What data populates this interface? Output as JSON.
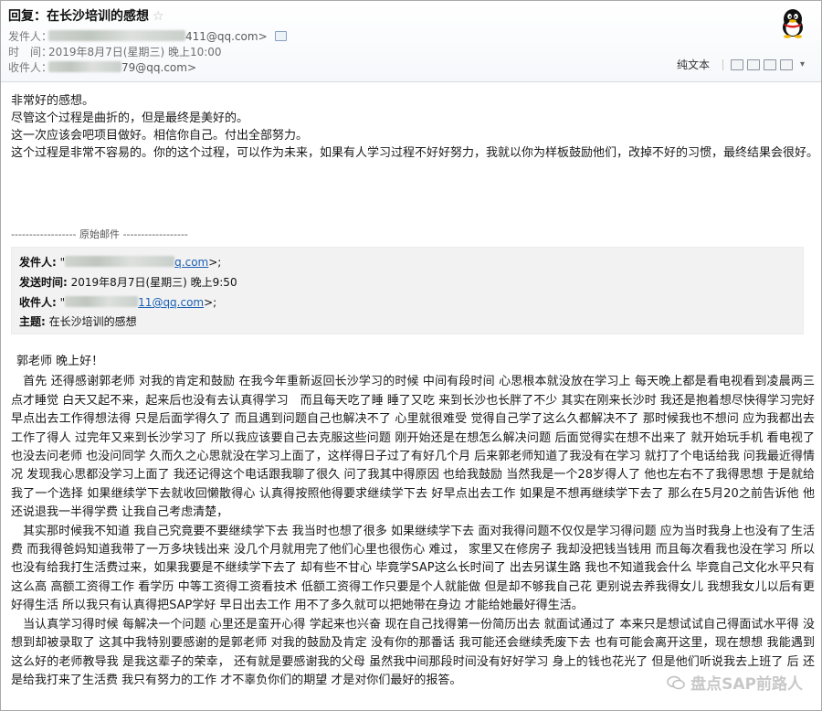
{
  "header": {
    "subject": "回复：在长沙培训的感想",
    "from_label": "发件人：",
    "from_addr": "411@qq.com>",
    "time_label": "时　间：",
    "time_value": "2019年8月7日(星期三) 晚上10:00",
    "to_label": "收件人：",
    "to_addr": "79@qq.com>",
    "plain_text": "纯文本"
  },
  "reply_lines": [
    "非常好的感想。",
    "尽管这个过程是曲折的，但是最终是美好的。",
    "这一次应该会吧项目做好。相信你自己。付出全部努力。",
    "这个过程是非常不容易的。你的这个过程，可以作为未来，如果有人学习过程不好好努力，我就以你为样板鼓励他们，改掉不好的习惯，最终结果会很好。"
  ],
  "original": {
    "title": "------------------ 原始邮件 ------------------",
    "from_label": "发件人:",
    "from_value": "\"",
    "from_addr": "q.com",
    "from_tail": ">;",
    "sent_label": "发送时间:",
    "sent_value": "2019年8月7日(星期三) 晚上9:50",
    "to_label": "收件人:",
    "to_value": "\"",
    "to_addr": "11@qq.com",
    "to_tail": ">;",
    "subject_label": "主题:",
    "subject_value": "在长沙培训的感想"
  },
  "letter": {
    "greeting": "郭老师 晚上好！",
    "paragraphs": [
      "　首先 还得感谢郭老师 对我的肯定和鼓励 在我今年重新返回长沙学习的时候 中间有段时间 心思根本就没放在学习上 每天晚上都是看电视看到凌晨两三点才睡觉 白天又起不来，起来后也没有去认真得学习　而且每天吃了睡 睡了又吃 来到长沙也长胖了不少 其实在刚来长沙时 我还是抱着想尽快得学习完好早点出去工作得想法得 只是后面学得久了 而且遇到问题自己也解决不了 心里就很难受 觉得自己学了这么久都解决不了 那时候我也不想问 应为我都出去工作了得人 过完年又来到长沙学习了 所以我应该要自己去克服这些问题 刚开始还是在想怎么解决问题 后面觉得实在想不出来了 就开始玩手机 看电视了 也没去问老师 也没问同学 久而久之心思就没在学习上面了，这样得日子过了有好几个月 后来郭老师知道了我没有在学习 就打了个电话给我 问我最近得情况 发现我心思都没学习上面了 我还记得这个电话跟我聊了很久 问了我其中得原因 也给我鼓励 当然我是一个28岁得人了 他也左右不了我得思想 于是就给我了一个选择 如果继续学下去就收回懒散得心 认真得按照他得要求继续学下去 好早点出去工作 如果是不想再继续学下去了 那么在5月20之前告诉他 他还说退我一半得学费 让我自己考虑清楚，",
      "　其实那时候我不知道 我自己究竟要不要继续学下去 我当时也想了很多 如果继续学下去 面对我得问题不仅仅是学习得问题 应为当时我身上也没有了生活费 而我得爸妈知道我带了一万多块钱出来 没几个月就用完了他们心里也很伤心 难过， 家里又在修房子 我却没把钱当钱用 而且每次看我也没在学习 所以也没有给我打生活费过来，如果我要是不继续学下去了 却有些不甘心 毕竟学SAP这么长时间了 出去另谋生路 我也不知道我会什么 毕竟自己文化水平只有这么高 高额工资得工作 看学历 中等工资得工资看技术 低额工资得工作只要是个人就能做 但是却不够我自己花 更别说去养我得女儿 我想我女儿以后有更好得生活 所以我只有认真得把SAP学好 早日出去工作 用不了多久就可以把她带在身边 才能给她最好得生活。",
      "　当认真学习得时候 每解决一个问题 心里还是蛮开心得 学起来也兴奋 现在自己找得第一份简历出去 就面试通过了 本来只是想试试自己得面试水平得 没想到却被录取了 这其中我特别要感谢的是郭老师 对我的鼓励及肯定 没有你的那番话 我可能还会继续秃废下去 也有可能会离开这里，现在想想 我能遇到这么好的老师教导我 是我这辈子的荣幸， 还有就是要感谢我的父母 虽然我中间那段时间没有好好学习 身上的钱也花光了 但是他们听说我去上班了 后 还是给我打来了生活费 我只有努力的工作 才不辜负你们的期望 才是对你们最好的报答。"
    ]
  },
  "watermark": "盘点SAP前路人",
  "icons": [
    "star-icon",
    "contact-card-icon",
    "qq-penguin-icon",
    "toolbar-window-icon",
    "toolbar-print-icon",
    "toolbar-chevron-icon"
  ]
}
